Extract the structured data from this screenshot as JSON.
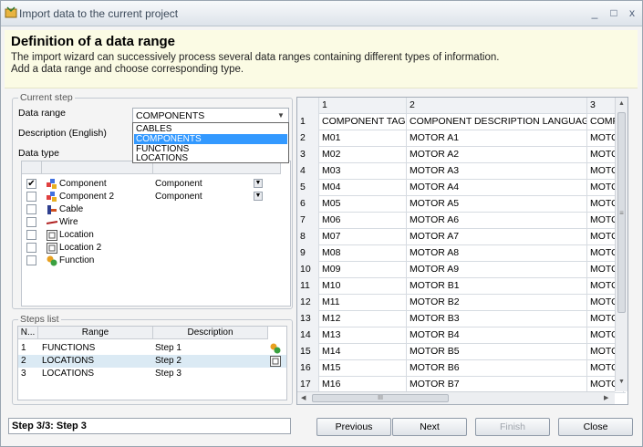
{
  "window": {
    "title": "Import data to the current project",
    "minimize": "_",
    "maximize": "□",
    "close": "x"
  },
  "header": {
    "title": "Definition of a data range",
    "line1": "The import wizard can successively process several data ranges containing different types of information.",
    "line2": "Add a data range and choose corresponding type."
  },
  "current_step": {
    "group_label": "Current step",
    "data_range_label": "Data range",
    "data_range_value": "COMPONENTS",
    "description_label": "Description (English)",
    "description_value": "",
    "data_type_label": "Data type",
    "dropdown_options": [
      "CABLES",
      "COMPONENTS",
      "FUNCTIONS",
      "LOCATIONS"
    ],
    "dropdown_selected_index": 1,
    "data_types": [
      {
        "checked": true,
        "name": "Component",
        "type": "Component",
        "icon": "component-icon"
      },
      {
        "checked": false,
        "name": "Component 2",
        "type": "Component",
        "icon": "component-icon"
      },
      {
        "checked": false,
        "name": "Cable",
        "type": "",
        "icon": "cable-icon"
      },
      {
        "checked": false,
        "name": "Wire",
        "type": "",
        "icon": "wire-icon"
      },
      {
        "checked": false,
        "name": "Location",
        "type": "",
        "icon": "location-icon"
      },
      {
        "checked": false,
        "name": "Location 2",
        "type": "",
        "icon": "location-icon"
      },
      {
        "checked": false,
        "name": "Function",
        "type": "",
        "icon": "function-icon"
      }
    ]
  },
  "steps_list": {
    "group_label": "Steps list",
    "columns": [
      "N...",
      "Range",
      "Description"
    ],
    "rows": [
      {
        "n": "1",
        "range": "FUNCTIONS",
        "description": "Step 1",
        "icon": "function-icon",
        "selected": false
      },
      {
        "n": "2",
        "range": "LOCATIONS",
        "description": "Step 2",
        "icon": "location-icon",
        "selected": true
      },
      {
        "n": "3",
        "range": "LOCATIONS",
        "description": "Step 3",
        "icon": "",
        "selected": false
      }
    ]
  },
  "grid": {
    "columns": [
      "",
      "1",
      "2",
      "3"
    ],
    "rows": [
      [
        "1",
        "COMPONENT TAG",
        "COMPONENT DESCRIPTION LANGUAGE 1",
        "COMP"
      ],
      [
        "2",
        "M01",
        "MOTOR A1",
        "MOTO"
      ],
      [
        "3",
        "M02",
        "MOTOR A2",
        "MOTO"
      ],
      [
        "4",
        "M03",
        "MOTOR A3",
        "MOTO"
      ],
      [
        "5",
        "M04",
        "MOTOR A4",
        "MOTO"
      ],
      [
        "6",
        "M05",
        "MOTOR A5",
        "MOTO"
      ],
      [
        "7",
        "M06",
        "MOTOR A6",
        "MOTO"
      ],
      [
        "8",
        "M07",
        "MOTOR A7",
        "MOTO"
      ],
      [
        "9",
        "M08",
        "MOTOR A8",
        "MOTO"
      ],
      [
        "10",
        "M09",
        "MOTOR A9",
        "MOTO"
      ],
      [
        "11",
        "M10",
        "MOTOR B1",
        "MOTO"
      ],
      [
        "12",
        "M11",
        "MOTOR B2",
        "MOTO"
      ],
      [
        "13",
        "M12",
        "MOTOR B3",
        "MOTO"
      ],
      [
        "14",
        "M13",
        "MOTOR B4",
        "MOTO"
      ],
      [
        "15",
        "M14",
        "MOTOR B5",
        "MOTO"
      ],
      [
        "16",
        "M15",
        "MOTOR B6",
        "MOTO"
      ],
      [
        "17",
        "M16",
        "MOTOR B7",
        "MOTO"
      ]
    ],
    "hscroll_grip": "III",
    "vscroll_grip": "≡"
  },
  "footer": {
    "status": "Step 3/3: Step 3",
    "previous": "Previous",
    "next": "Next",
    "finish": "Finish",
    "close": "Close"
  }
}
